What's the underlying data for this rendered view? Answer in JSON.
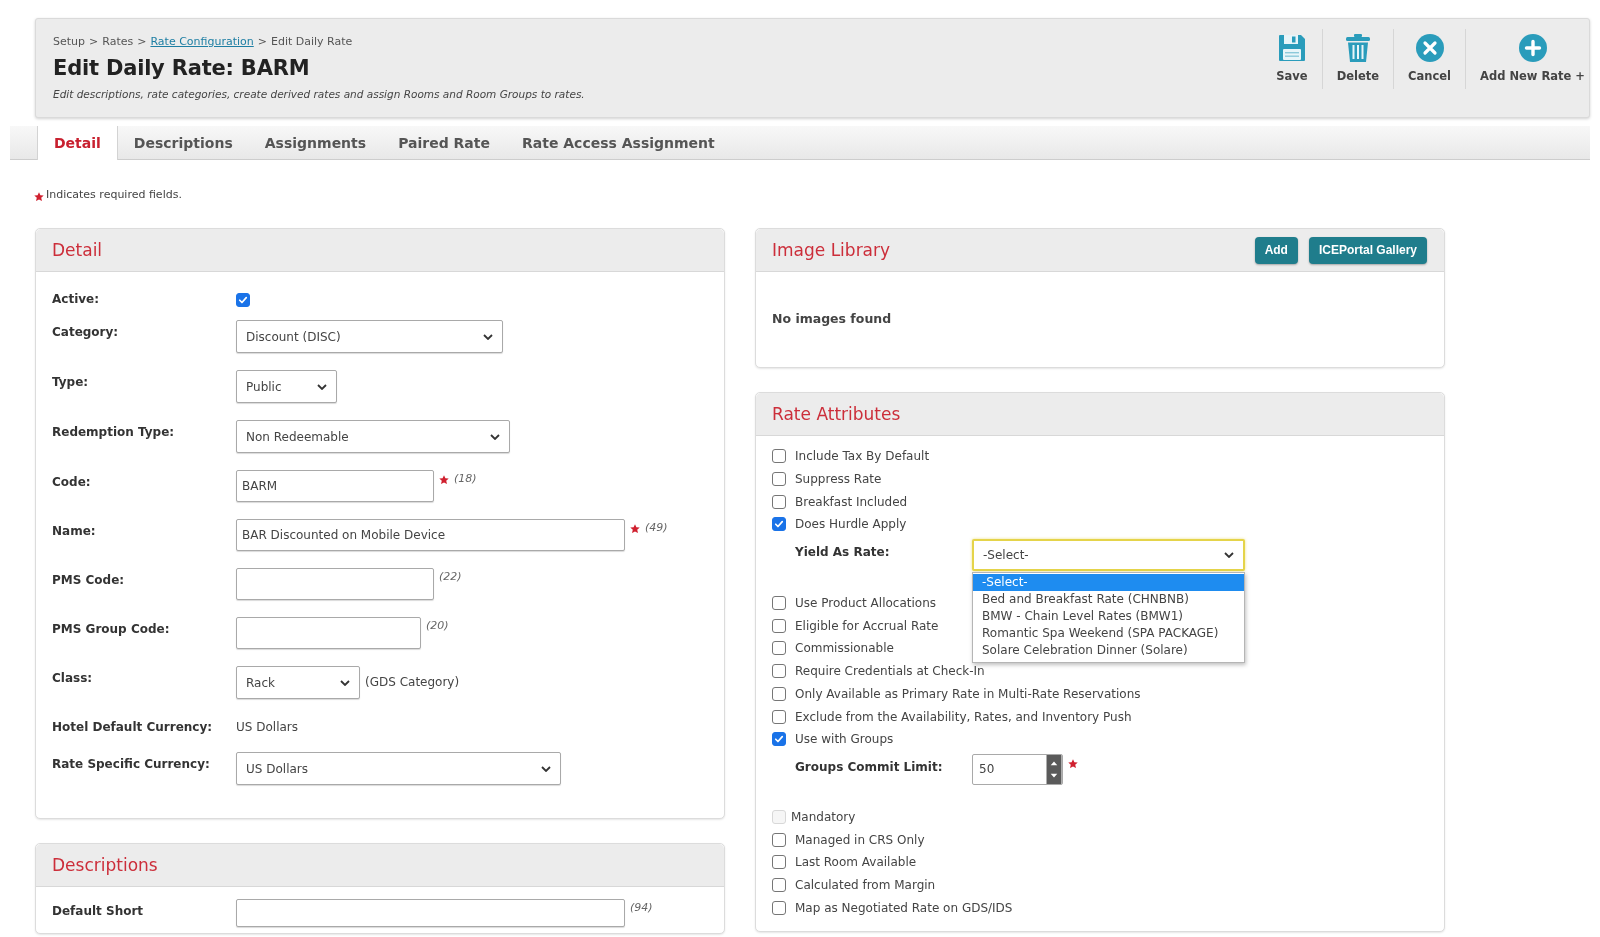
{
  "breadcrumb": [
    {
      "label": "Setup",
      "link": false
    },
    {
      "separator": ">",
      "label": "Rates",
      "link": false
    },
    {
      "separator": ">",
      "label": "Rate Configuration",
      "link": true
    },
    {
      "separator": ">",
      "label": "Edit Daily Rate",
      "link": false
    }
  ],
  "title": "Edit Daily Rate: BARM",
  "subtitle": "Edit descriptions, rate categories, create derived rates and assign Rooms and Room Groups to rates.",
  "toolbar": [
    {
      "kind": "save",
      "label": "Save"
    },
    {
      "kind": "delete",
      "label": "Delete"
    },
    {
      "kind": "cancel",
      "label": "Cancel"
    },
    {
      "kind": "add",
      "label": "Add New Rate +"
    }
  ],
  "tabs": [
    {
      "label": "Detail",
      "selected": true
    },
    {
      "label": "Descriptions",
      "selected": false
    },
    {
      "label": "Assignments",
      "selected": false
    },
    {
      "label": "Paired Rate",
      "selected": false
    },
    {
      "label": "Rate Access Assignment",
      "selected": false
    }
  ],
  "required_note": "Indicates required fields.",
  "detail": {
    "title": "Detail",
    "fields": [
      {
        "kind": "checkbox",
        "label": "Active:",
        "checked": true,
        "required": false
      },
      {
        "kind": "select",
        "label": "Category:",
        "value": "Discount (DISC)",
        "required": false
      },
      {
        "kind": "select",
        "label": "Type:",
        "value": "Public",
        "required": false
      },
      {
        "kind": "select",
        "label": "Redemption Type:",
        "value": "Non Redeemable",
        "required": false
      },
      {
        "kind": "input",
        "label": "Code:",
        "value": "BARM",
        "required": true,
        "count": "(18)"
      },
      {
        "kind": "input",
        "label": "Name:",
        "value": "BAR Discounted on Mobile Device",
        "required": true,
        "count": "(49)"
      },
      {
        "kind": "input",
        "label": "PMS Code:",
        "required": false,
        "count": "(22)"
      },
      {
        "kind": "input",
        "label": "PMS Group Code:",
        "required": false,
        "count": "(20)"
      },
      {
        "kind": "select",
        "label": "Class:",
        "value": "Rack",
        "required": false,
        "note": "(GDS Category)"
      },
      {
        "kind": "text",
        "label": "Hotel Default Currency:",
        "value": "US Dollars",
        "required": false
      },
      {
        "kind": "select",
        "label": "Rate Specific Currency:",
        "value": "US Dollars",
        "required": false
      }
    ]
  },
  "descriptions": {
    "title": "Descriptions",
    "fields": [
      {
        "kind": "input",
        "label": "Default Short",
        "required": false,
        "count": "(94)"
      }
    ]
  },
  "image_library": {
    "title": "Image Library",
    "buttons": [
      "Add",
      "ICEPortal Gallery"
    ],
    "empty_text": "No images found"
  },
  "rate_attributes": {
    "title": "Rate Attributes",
    "items": [
      {
        "kind": "checkbox",
        "label": "Include Tax By Default",
        "checked": false,
        "disabled": false
      },
      {
        "kind": "checkbox",
        "label": "Suppress Rate",
        "checked": false,
        "disabled": false
      },
      {
        "kind": "checkbox",
        "label": "Breakfast Included",
        "checked": false,
        "disabled": false
      },
      {
        "kind": "checkbox",
        "label": "Does Hurdle Apply",
        "checked": true,
        "disabled": false,
        "children": [
          {
            "kind": "select",
            "label": "Yield As Rate:",
            "value": "-Select-",
            "focused": true,
            "open": true,
            "options": [
              {
                "label": "-Select-",
                "selected": true
              },
              {
                "label": "Bed and Breakfast Rate (CHNBNB)",
                "selected": false
              },
              {
                "label": "BMW - Chain Level Rates (BMW1)",
                "selected": false
              },
              {
                "label": "Romantic Spa Weekend (SPA PACKAGE)",
                "selected": false
              },
              {
                "label": "Solare Celebration Dinner (Solare)",
                "selected": false
              }
            ]
          }
        ]
      },
      {
        "kind": "checkbox",
        "label": "Use Product Allocations",
        "checked": false,
        "disabled": false
      },
      {
        "kind": "checkbox",
        "label": "Eligible for Accrual Rate",
        "checked": false,
        "disabled": false
      },
      {
        "kind": "checkbox",
        "label": "Commissionable",
        "checked": false,
        "disabled": false
      },
      {
        "kind": "checkbox",
        "label": "Require Credentials at Check-In",
        "checked": false,
        "disabled": false
      },
      {
        "kind": "checkbox",
        "label": "Only Available as Primary Rate in Multi-Rate Reservations",
        "checked": false,
        "disabled": false
      },
      {
        "kind": "checkbox",
        "label": "Exclude from the Availability, Rates, and Inventory Push",
        "checked": false,
        "disabled": false
      },
      {
        "kind": "checkbox",
        "label": "Use with Groups",
        "checked": true,
        "disabled": false,
        "children": [
          {
            "kind": "spinner",
            "label": "Groups Commit Limit:",
            "value": "50",
            "required": true
          }
        ]
      },
      {
        "kind": "checkbox",
        "label": "Mandatory",
        "checked": false,
        "disabled": true
      },
      {
        "kind": "checkbox",
        "label": "Managed in CRS Only",
        "checked": false,
        "disabled": false
      },
      {
        "kind": "checkbox",
        "label": "Last Room Available",
        "checked": false,
        "disabled": false
      },
      {
        "kind": "checkbox",
        "label": "Calculated from Margin",
        "checked": false,
        "disabled": false
      },
      {
        "kind": "checkbox",
        "label": "Map as Negotiated Rate on GDS/IDS",
        "checked": false,
        "disabled": false
      }
    ]
  }
}
